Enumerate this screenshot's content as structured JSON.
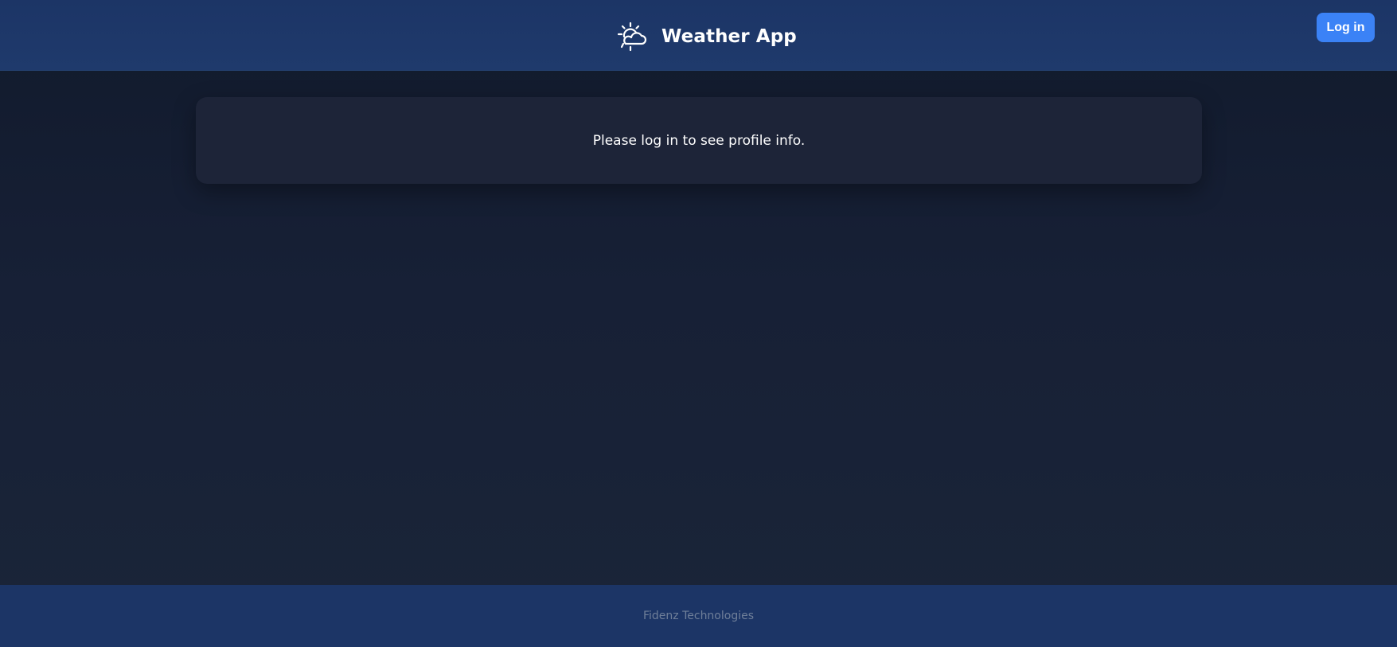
{
  "header": {
    "title": "Weather App",
    "logo_icon": "sun-cloud-icon",
    "login_label": "Log in"
  },
  "main": {
    "message": "Please log in to see profile info."
  },
  "footer": {
    "text": "Fidenz Technologies"
  },
  "colors": {
    "header_bg": "#1c3566",
    "accent": "#3b82f6",
    "card_bg": "#1d2438",
    "footer_text": "#6f7f99"
  }
}
